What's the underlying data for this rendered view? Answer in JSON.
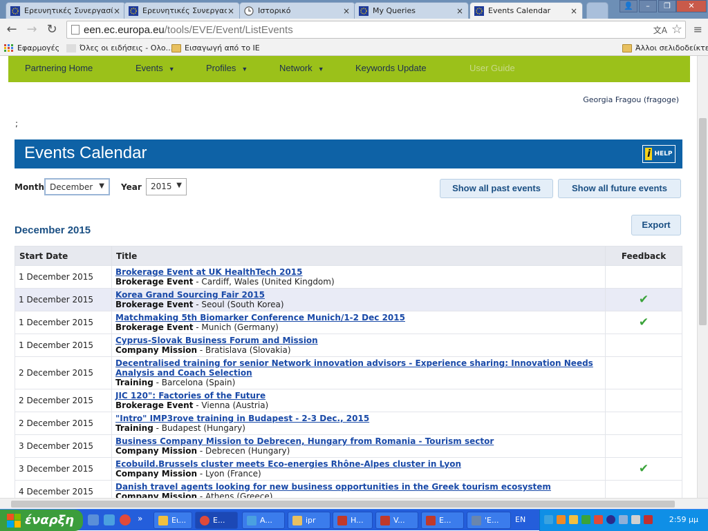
{
  "browser": {
    "tabs": [
      {
        "label": "Ερευνητικές Συνεργασίε",
        "icon": "eu-flag-icon"
      },
      {
        "label": "Ερευνητικές Συνεργασίε",
        "icon": "eu-flag-icon"
      },
      {
        "label": "Ιστορικό",
        "icon": "history-clock-icon"
      },
      {
        "label": "My Queries",
        "icon": "eu-flag-icon"
      },
      {
        "label": "Events Calendar",
        "icon": "eu-flag-icon"
      }
    ],
    "tab_close": "×",
    "url_host": "een.ec.europa.eu",
    "url_path": "/tools/EVE/Event/ListEvents",
    "bookmarks": [
      {
        "label": "Εφαρμογές",
        "icon": "apps-grid-icon"
      },
      {
        "label": "Όλες οι ειδήσεις - Ολο...",
        "icon": "news-site-icon"
      },
      {
        "label": "Εισαγωγή από το IE",
        "icon": "folder-icon"
      },
      {
        "label": "Άλλοι σελιδοδείκτες",
        "icon": "folder-icon"
      }
    ]
  },
  "nav": {
    "items": [
      {
        "label": "Partnering Home",
        "has_menu": false
      },
      {
        "label": "Events",
        "has_menu": true
      },
      {
        "label": "Profiles",
        "has_menu": true
      },
      {
        "label": "Network",
        "has_menu": true
      },
      {
        "label": "Keywords Update",
        "has_menu": false
      },
      {
        "label": "User Guide",
        "has_menu": false,
        "disabled": true
      }
    ],
    "caret": "▼"
  },
  "user": {
    "display": "Georgia Fragou (fragoge)"
  },
  "stray_text": ";",
  "page": {
    "title": "Events Calendar",
    "help_label": "HELP",
    "help_icon_glyph": "i"
  },
  "filters": {
    "month_label": "Month",
    "month_value": "December",
    "year_label": "Year",
    "year_value": "2015",
    "arrow": "▼"
  },
  "buttons": {
    "past": "Show all past events",
    "future": "Show all future events",
    "export": "Export"
  },
  "section": {
    "heading": "December 2015"
  },
  "table": {
    "headers": {
      "date": "Start Date",
      "title": "Title",
      "feedback": "Feedback"
    },
    "rows": [
      {
        "date": "1 December 2015",
        "title": "Brokerage Event at UK HealthTech 2015",
        "category": "Brokerage Event",
        "location": " - Cardiff, Wales (United Kingdom)",
        "feedback": ""
      },
      {
        "date": "1 December 2015",
        "title": "Korea Grand Sourcing Fair 2015",
        "category": "Brokerage Event",
        "location": " - Seoul (South Korea)",
        "feedback": "✔"
      },
      {
        "date": "1 December 2015",
        "title": "Matchmaking 5th Biomarker Conference Munich/1-2 Dec 2015",
        "category": "Brokerage Event",
        "location": " - Munich (Germany)",
        "feedback": "✔"
      },
      {
        "date": "1 December 2015",
        "title": "Cyprus-Slovak Business Forum and Mission",
        "category": "Company Mission",
        "location": " - Bratislava (Slovakia)",
        "feedback": ""
      },
      {
        "date": "2 December 2015",
        "title": "Decentralised training for senior Network innovation advisors - Experience sharing: Innovation Needs Analysis and Coach Selection",
        "category": "Training",
        "location": " - Barcelona (Spain)",
        "feedback": ""
      },
      {
        "date": "2 December 2015",
        "title": "JIC 120\": Factories of the Future",
        "category": "Brokerage Event",
        "location": " - Vienna (Austria)",
        "feedback": ""
      },
      {
        "date": "2 December 2015",
        "title": "\"Intro\" IMP3rove training in Budapest - 2-3 Dec., 2015",
        "category": "Training",
        "location": " - Budapest (Hungary)",
        "feedback": ""
      },
      {
        "date": "3 December 2015",
        "title": "Business Company Mission to Debrecen, Hungary from Romania - Tourism sector",
        "category": "Company Mission",
        "location": " - Debrecen (Hungary)",
        "feedback": ""
      },
      {
        "date": "3 December 2015",
        "title": "Ecobuild.Brussels cluster meets Eco-energies Rhône-Alpes cluster in Lyon",
        "category": "Company Mission",
        "location": " - Lyon (France)",
        "feedback": "✔"
      },
      {
        "date": "4 December 2015",
        "title": "Danish travel agents looking for new business opportunities in the Greek tourism ecosystem",
        "category": "Company Mission",
        "location": " - Athens (Greece)",
        "feedback": ""
      }
    ]
  },
  "taskbar": {
    "start_label": "έναρξη",
    "overflow": "»",
    "tasks": [
      {
        "label": "Ει...",
        "icon": "mail-icon"
      },
      {
        "label": "E...",
        "icon": "chrome-icon"
      },
      {
        "label": "A...",
        "icon": "ie-icon"
      },
      {
        "label": "ipr",
        "icon": "folder-icon"
      },
      {
        "label": "H...",
        "icon": "document-icon"
      },
      {
        "label": "V...",
        "icon": "document-icon"
      },
      {
        "label": "E...",
        "icon": "document-icon"
      },
      {
        "label": "'E...",
        "icon": "document-icon"
      }
    ],
    "language": "EN",
    "clock": "2:59 μμ"
  },
  "colors": {
    "nav_green": "#9bc11a",
    "title_blue": "#0e62a6",
    "link_blue": "#1a4aa8",
    "check_green": "#3aa33a"
  }
}
